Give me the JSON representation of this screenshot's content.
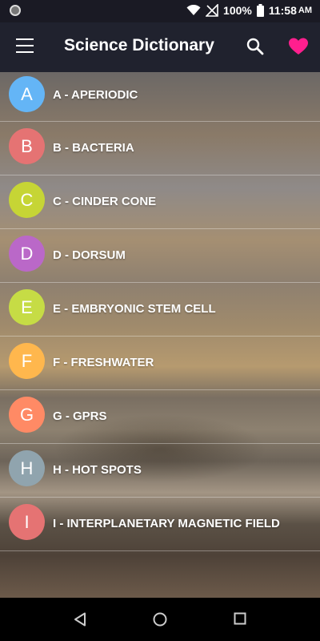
{
  "status_bar": {
    "battery": "100%",
    "time": "11:58",
    "ampm": "AM"
  },
  "app_bar": {
    "title": "Science Dictionary",
    "icons": [
      "menu-icon",
      "search-icon",
      "heart-icon"
    ],
    "accent_color": "#ff1f8e"
  },
  "letters": [
    {
      "letter": "A",
      "label": "A - APERIODIC",
      "color": "#64b5f6"
    },
    {
      "letter": "B",
      "label": "B - BACTERIA",
      "color": "#e57373"
    },
    {
      "letter": "C",
      "label": "C - CINDER CONE",
      "color": "#c6d535"
    },
    {
      "letter": "D",
      "label": "D - DORSUM",
      "color": "#ba68c8"
    },
    {
      "letter": "E",
      "label": "E - EMBRYONIC STEM CELL",
      "color": "#c6dc45"
    },
    {
      "letter": "F",
      "label": "F - FRESHWATER",
      "color": "#ffb74d"
    },
    {
      "letter": "G",
      "label": "G - GPRS",
      "color": "#ff8a65"
    },
    {
      "letter": "H",
      "label": "H - HOT SPOTS",
      "color": "#90a4ae"
    },
    {
      "letter": "I",
      "label": "I - INTERPLANETARY MAGNETIC FIELD",
      "color": "#e57373"
    }
  ],
  "nav_bar": {
    "icons": [
      "back-icon",
      "home-icon",
      "recents-icon"
    ]
  }
}
